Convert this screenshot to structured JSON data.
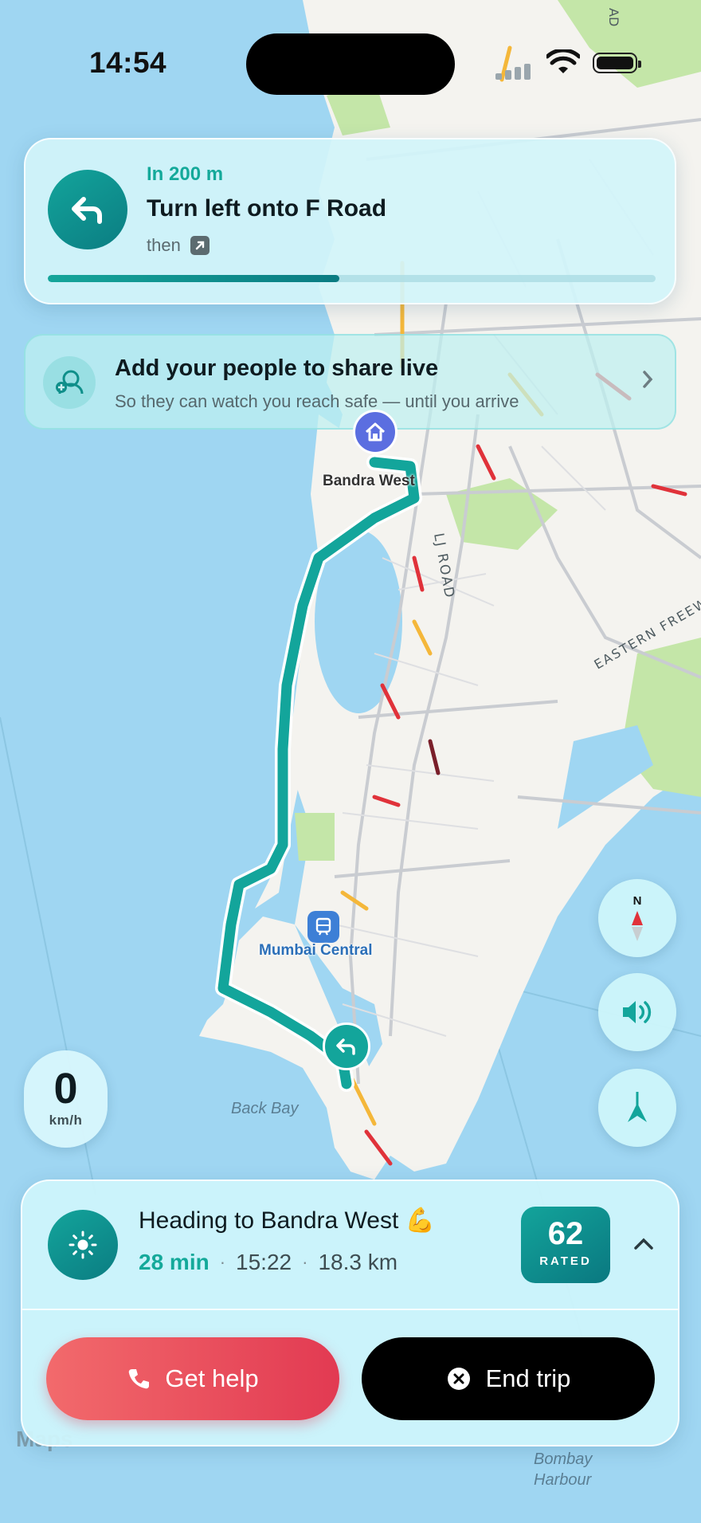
{
  "status_bar": {
    "time": "14:54"
  },
  "navigation": {
    "distance": "In 200 m",
    "instruction": "Turn left onto F Road",
    "then_label": "then",
    "progress": 0.48
  },
  "share_banner": {
    "title": "Add your people to share live",
    "subtitle": "So they can watch you reach safe — until you arrive"
  },
  "map": {
    "labels": {
      "bandra_west": "Bandra West",
      "mumbai_central": "Mumbai Central",
      "back_bay": "Back Bay",
      "lj_road": "LJ ROAD",
      "eastern_freeway": "EASTERN FREEW",
      "bombay_harbour": "Bombay\nHarbour"
    },
    "route_color": "#13a59b",
    "water_color": "#9fd6f2",
    "land_color": "#f4f3ef"
  },
  "speed": {
    "value": "0",
    "unit": "km/h"
  },
  "compass": {
    "north_label": "N"
  },
  "trip": {
    "heading": "Heading to Bandra West 💪",
    "eta_minutes": "28 min",
    "arrival_time": "15:22",
    "distance": "18.3 km",
    "score": "62",
    "score_label": "RATED"
  },
  "actions": {
    "get_help": "Get help",
    "end_trip": "End trip"
  },
  "attribution": {
    "maps": " Maps"
  },
  "icons": [
    "turn-left-icon",
    "arrow-up-right-icon",
    "share-people-icon",
    "chevron-right-icon",
    "home-icon",
    "train-icon",
    "compass-icon",
    "speaker-icon",
    "recenter-arrow-icon",
    "sun-icon",
    "chevron-up-icon",
    "phone-icon",
    "close-circle-icon",
    "wifi-icon",
    "battery-icon"
  ]
}
